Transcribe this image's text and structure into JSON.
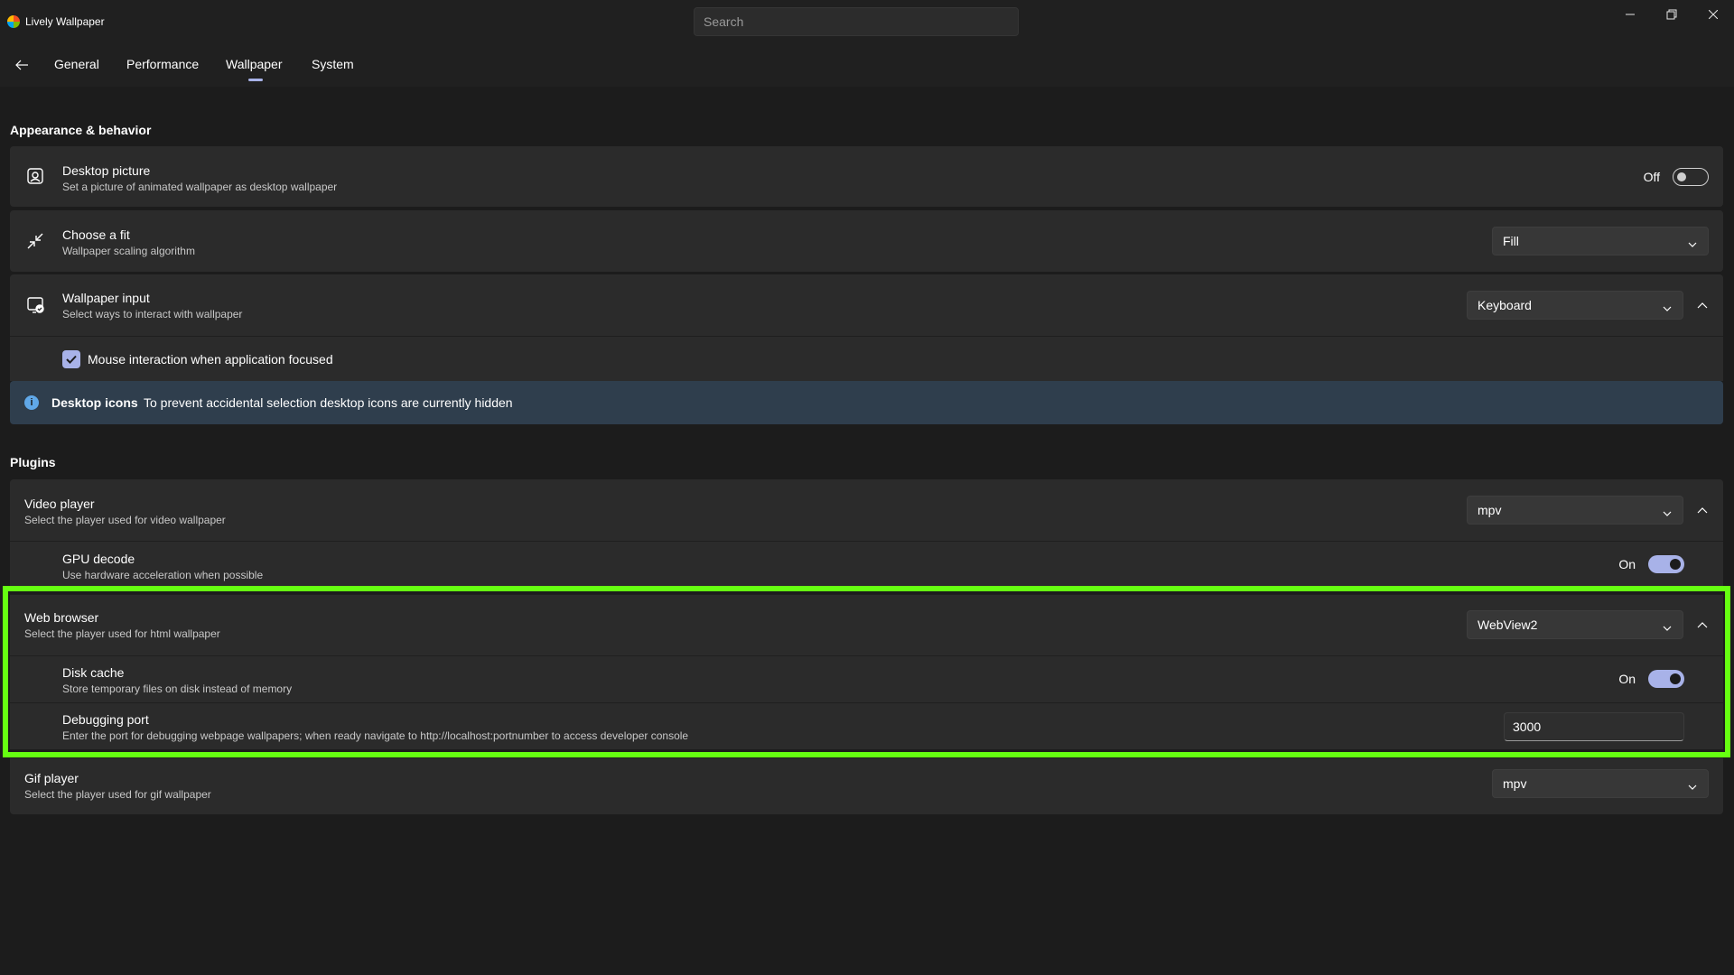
{
  "app": {
    "title": "Lively Wallpaper"
  },
  "search": {
    "placeholder": "Search"
  },
  "tabs": [
    {
      "label": "General"
    },
    {
      "label": "Performance"
    },
    {
      "label": "Wallpaper",
      "selected": true
    },
    {
      "label": "System"
    }
  ],
  "appearance": {
    "section_title": "Appearance & behavior",
    "desktop_picture": {
      "title": "Desktop picture",
      "desc": "Set a picture of animated wallpaper as desktop wallpaper",
      "toggle_label": "Off",
      "value": false
    },
    "choose_fit": {
      "title": "Choose a fit",
      "desc": "Wallpaper scaling algorithm",
      "value": "Fill"
    },
    "wallpaper_input": {
      "title": "Wallpaper input",
      "desc": "Select ways to interact with wallpaper",
      "value": "Keyboard",
      "mouse_interaction": {
        "label": "Mouse interaction when application focused",
        "checked": true
      }
    },
    "info": {
      "title": "Desktop icons",
      "message": "To prevent accidental selection desktop icons are currently hidden"
    }
  },
  "plugins": {
    "section_title": "Plugins",
    "video_player": {
      "title": "Video player",
      "desc": "Select the player used for video wallpaper",
      "value": "mpv",
      "gpu_decode": {
        "title": "GPU decode",
        "desc": "Use hardware acceleration when possible",
        "toggle_label": "On",
        "value": true
      }
    },
    "web_browser": {
      "title": "Web browser",
      "desc": "Select the player used for html wallpaper",
      "value": "WebView2",
      "disk_cache": {
        "title": "Disk cache",
        "desc": "Store temporary files on disk instead of memory",
        "toggle_label": "On",
        "value": true
      },
      "debugging_port": {
        "title": "Debugging port",
        "desc": "Enter the port for debugging webpage wallpapers; when ready navigate to http://localhost:portnumber to access developer console",
        "value": "3000"
      }
    },
    "gif_player": {
      "title": "Gif player",
      "desc": "Select the player used for gif wallpaper",
      "value": "mpv"
    }
  },
  "colors": {
    "accent": "#a8b2e8",
    "highlight": "#66ff11",
    "info_bg": "#2f3e4d"
  }
}
